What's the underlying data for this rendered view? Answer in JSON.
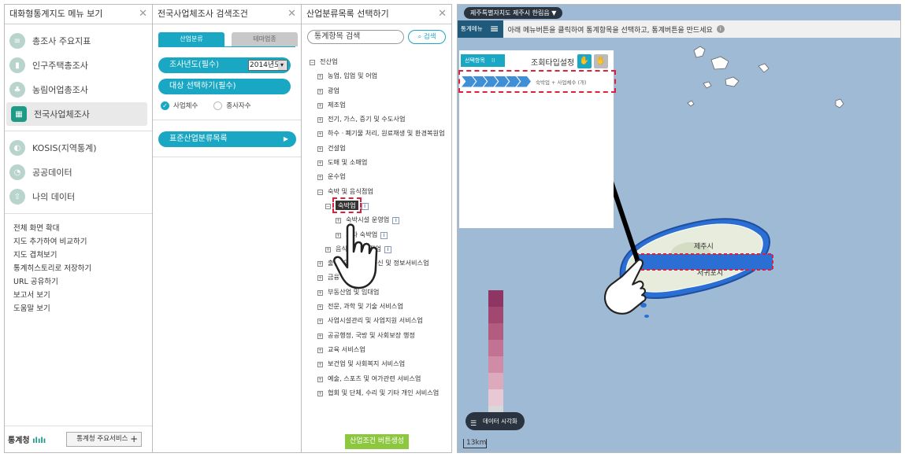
{
  "panel1": {
    "title": "대화형통계지도 메뉴 보기",
    "menu": [
      {
        "label": "총조사 주요지표",
        "icon": "survey-icon"
      },
      {
        "label": "인구주택총조사",
        "icon": "chart-icon"
      },
      {
        "label": "농림어업총조사",
        "icon": "tree-icon"
      },
      {
        "label": "전국사업체조사",
        "icon": "building-icon"
      }
    ],
    "menu2": [
      {
        "label": "KOSIS(지역통계)",
        "icon": "kosis-icon"
      },
      {
        "label": "공공데이터",
        "icon": "pie-icon"
      },
      {
        "label": "나의 데이터",
        "icon": "upload-icon"
      }
    ],
    "links": [
      "전체 화면 확대",
      "지도 추가하여 비교하기",
      "지도 겹쳐보기",
      "통계히스토리로 저장하기",
      "URL 공유하기",
      "보고서 보기",
      "도움말 보기"
    ],
    "logo": "통계청",
    "service_button": "통계청 주요서비스"
  },
  "panel2": {
    "title": "전국사업체조사 검색조건",
    "tab_on": "산업분류",
    "tab_off": "테마업종",
    "year_label": "조사년도(필수)",
    "year_value": "2014년도",
    "target_label": "대상 선택하기(필수)",
    "radio1": "사업체수",
    "radio2": "종사자수",
    "list_button": "표준산업분류목록"
  },
  "panel3": {
    "title": "산업분류목록 선택하기",
    "search_placeholder": "통계항목 검색",
    "search_button": "검색",
    "root": "전산업",
    "items1": [
      "농업, 임업 및 어업",
      "광업",
      "제조업",
      "전기, 가스, 증기 및 수도사업",
      "하수ㆍ폐기물 처리, 원료재생 및 환경복원업",
      "건설업",
      "도매 및 소매업",
      "운수업",
      "숙박 및 음식점업"
    ],
    "sub_selected": "숙박업",
    "sub_a": "숙박시설 운영업",
    "sub_b": "기타 숙박업",
    "sub_c": "음식점 및 주점업",
    "items2": [
      "출판, 영상, 방송통신 및 정보서비스업",
      "금융 및 보험업",
      "부동산업 및 임대업",
      "전문, 과학 및 기술 서비스업",
      "사업시설관리 및 사업지원 서비스업",
      "공공행정, 국방 및 사회보장 행정",
      "교육 서비스업",
      "보건업 및 사회복지 서비스업",
      "예술, 스포츠 및 여가관련 서비스업",
      "협회 및 단체, 수리 및 기타 개인 서비스업"
    ],
    "generate_button": "산업조건 버튼생성"
  },
  "map": {
    "region_badge": "제주특별자치도 제주시 한림읍",
    "menu_label": "통계메뉴",
    "info_text": "아래 메뉴버튼을 클릭하여 통계항목을 선택하고, 통계버튼을 만드세요",
    "select_label": "선택항목",
    "query_type": "조회타입설정",
    "chevron_label": "숙박업 + 사업체수 (개)",
    "city_jeju": "제주시",
    "city_seogwipo": "서귀포시",
    "data_vis": "데이터 시각화",
    "scale": "13km",
    "legend_colors": [
      "#8e3563",
      "#a2476f",
      "#b25c80",
      "#c27393",
      "#d08ca7",
      "#dca9bd",
      "#e7c8d4",
      "#d8d8d8"
    ]
  }
}
